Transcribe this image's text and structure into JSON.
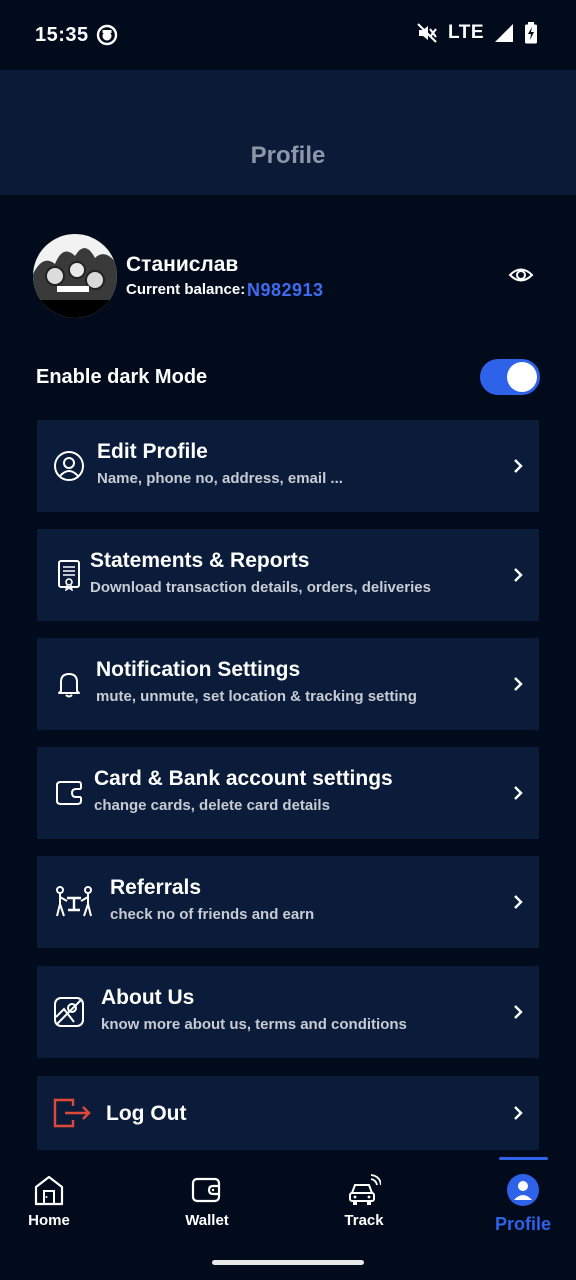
{
  "status_bar": {
    "time": "15:35",
    "network": "LTE",
    "icons": [
      "app-notification-icon",
      "mute-icon",
      "signal-icon",
      "battery-charging-icon"
    ]
  },
  "header": {
    "title": "Profile"
  },
  "user": {
    "name": "Станислав",
    "balance_label": "Current balance:",
    "balance_value": "N982913",
    "visibility_icon": "eye-icon"
  },
  "dark_mode": {
    "label": "Enable dark Mode",
    "enabled": true,
    "accent_color": "#2e62e8"
  },
  "menu": [
    {
      "title": "Edit Profile",
      "subtitle": "Name, phone no, address, email ...",
      "icon": "user-circle-icon"
    },
    {
      "title": "Statements & Reports",
      "subtitle": "Download transaction details, orders, deliveries",
      "icon": "document-certificate-icon"
    },
    {
      "title": "Notification Settings",
      "subtitle": "mute, unmute, set location & tracking setting",
      "icon": "bell-icon"
    },
    {
      "title": "Card & Bank account settings",
      "subtitle": "change cards, delete card details",
      "icon": "wallet-card-icon"
    },
    {
      "title": "Referrals",
      "subtitle": "check no of friends and earn",
      "icon": "referral-people-icon"
    },
    {
      "title": "About Us",
      "subtitle": "know more about us, terms and conditions",
      "icon": "image-info-icon"
    },
    {
      "title": "Log Out",
      "subtitle": "",
      "icon": "logout-icon",
      "icon_color": "#e0483a"
    }
  ],
  "bottom_nav": {
    "active": "Profile",
    "active_color": "#2e62e8",
    "items": [
      {
        "label": "Home",
        "icon": "home-icon"
      },
      {
        "label": "Wallet",
        "icon": "wallet-icon"
      },
      {
        "label": "Track",
        "icon": "car-tracking-icon"
      },
      {
        "label": "Profile",
        "icon": "profile-icon"
      }
    ]
  },
  "colors": {
    "background": "#020b1c",
    "card": "#0b1c3a",
    "header": "#0a1a37",
    "balance": "#3d6cf0"
  }
}
